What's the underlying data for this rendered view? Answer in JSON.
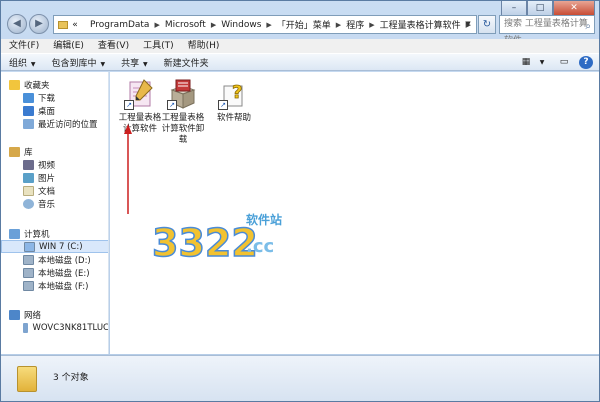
{
  "address_bar": {
    "path": [
      "ProgramData",
      "Microsoft",
      "Windows",
      "「开始」菜单",
      "程序",
      "工程量表格计算软件"
    ],
    "prefix": "«"
  },
  "search": {
    "placeholder": "搜索 工程量表格计算软件"
  },
  "menu": [
    "文件(F)",
    "编辑(E)",
    "查看(V)",
    "工具(T)",
    "帮助(H)"
  ],
  "commands": {
    "organize": "组织",
    "include_library": "包含到库中",
    "share": "共享",
    "new_folder": "新建文件夹"
  },
  "nav": {
    "favorites": {
      "label": "收藏夹",
      "items": [
        "下载",
        "桌面",
        "最近访问的位置"
      ]
    },
    "libraries": {
      "label": "库",
      "items": [
        "视频",
        "图片",
        "文档",
        "音乐"
      ]
    },
    "computer": {
      "label": "计算机",
      "items": [
        "WIN 7 (C:)",
        "本地磁盘 (D:)",
        "本地磁盘 (E:)",
        "本地磁盘 (F:)"
      ]
    },
    "network": {
      "label": "网络",
      "items": [
        "WOVC3NK81TLUC"
      ]
    }
  },
  "files": [
    {
      "label_line1": "工程量表格",
      "label_line2": "计算软件",
      "icon": "pencil-doc-icon"
    },
    {
      "label_line1": "工程量表格",
      "label_line2": "计算软件卸",
      "label_line3": "载",
      "icon": "uninstall-box-icon"
    },
    {
      "label_line1": "软件帮助",
      "icon": "help-doc-icon"
    }
  ],
  "watermark": {
    "digits": "3322",
    "domain": ".cc",
    "tag": "软件站"
  },
  "status": {
    "text": "3 个对象"
  },
  "colors": {
    "accent": "#2e6bc4",
    "arrow": "#cc1f1f"
  }
}
